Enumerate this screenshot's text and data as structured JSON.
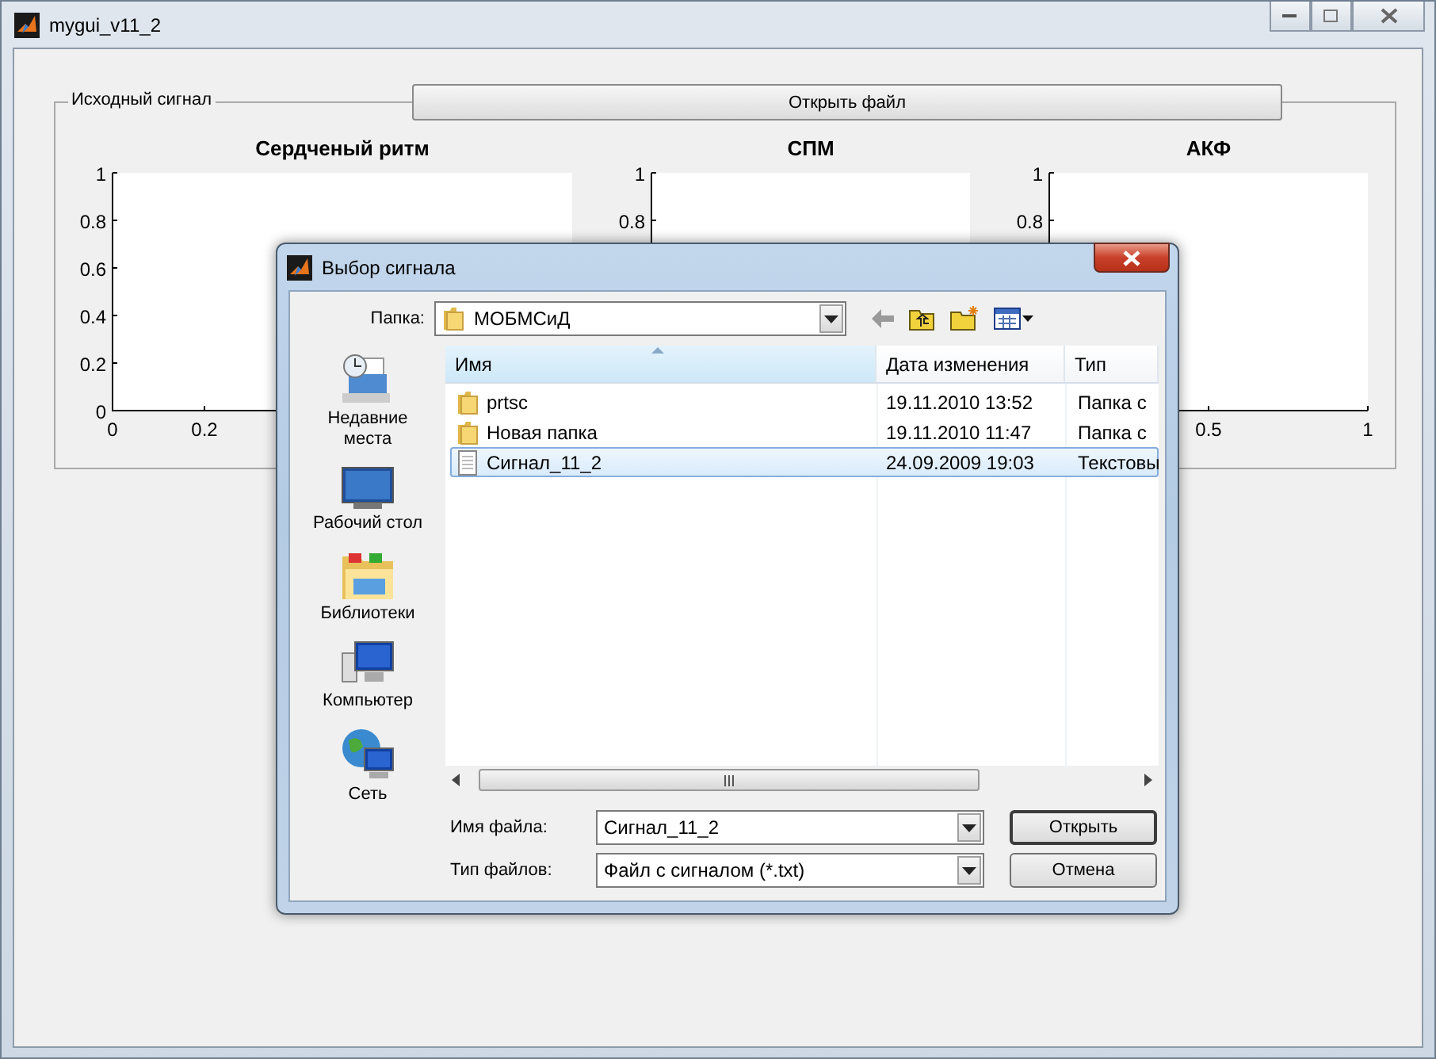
{
  "window": {
    "title": "mygui_v11_2"
  },
  "panel": {
    "title": "Исходный сигнал",
    "button": "Открыть файл",
    "plots": [
      {
        "chart_data": {
          "type": "line",
          "title": "Сердченый ритм",
          "xlim": [
            0,
            1
          ],
          "ylim": [
            0,
            1
          ],
          "xticks": [
            0,
            0.2
          ],
          "yticks": [
            0,
            0.2,
            0.4,
            0.6,
            0.8,
            1
          ]
        }
      },
      {
        "title": "СПМ",
        "y_tick_labels": [
          "1",
          "0.8"
        ]
      },
      {
        "chart_data": {
          "type": "line",
          "title": "АКФ",
          "xlim": [
            0,
            1
          ],
          "ylim": [
            0,
            1
          ],
          "xticks": [
            0.5,
            1
          ],
          "yticks": [
            0.8,
            1
          ]
        }
      }
    ]
  },
  "dialog": {
    "title": "Выбор сигнала",
    "folder_label": "Папка:",
    "folder": "МОБМСиД",
    "places": [
      {
        "label": "Недавние места",
        "kind": "recent"
      },
      {
        "label": "Рабочий стол",
        "kind": "desktop"
      },
      {
        "label": "Библиотеки",
        "kind": "libraries"
      },
      {
        "label": "Компьютер",
        "kind": "computer"
      },
      {
        "label": "Сеть",
        "kind": "network"
      }
    ],
    "columns": [
      "Имя",
      "Дата изменения",
      "Тип"
    ],
    "files": [
      {
        "name": "prtsc",
        "date": "19.11.2010 13:52",
        "type": "Папка с",
        "kind": "folder",
        "selected": false
      },
      {
        "name": "Новая папка",
        "date": "19.11.2010 11:47",
        "type": "Папка с",
        "kind": "folder",
        "selected": false
      },
      {
        "name": "Сигнал_11_2",
        "date": "24.09.2009 19:03",
        "type": "Текстовы",
        "kind": "text",
        "selected": true
      }
    ],
    "filename_label": "Имя файла:",
    "filename": "Сигнал_11_2",
    "filetype_label": "Тип файлов:",
    "filetype": "Файл с сигналом (*.txt)",
    "buttons": [
      "Открыть",
      "Отмена"
    ]
  }
}
